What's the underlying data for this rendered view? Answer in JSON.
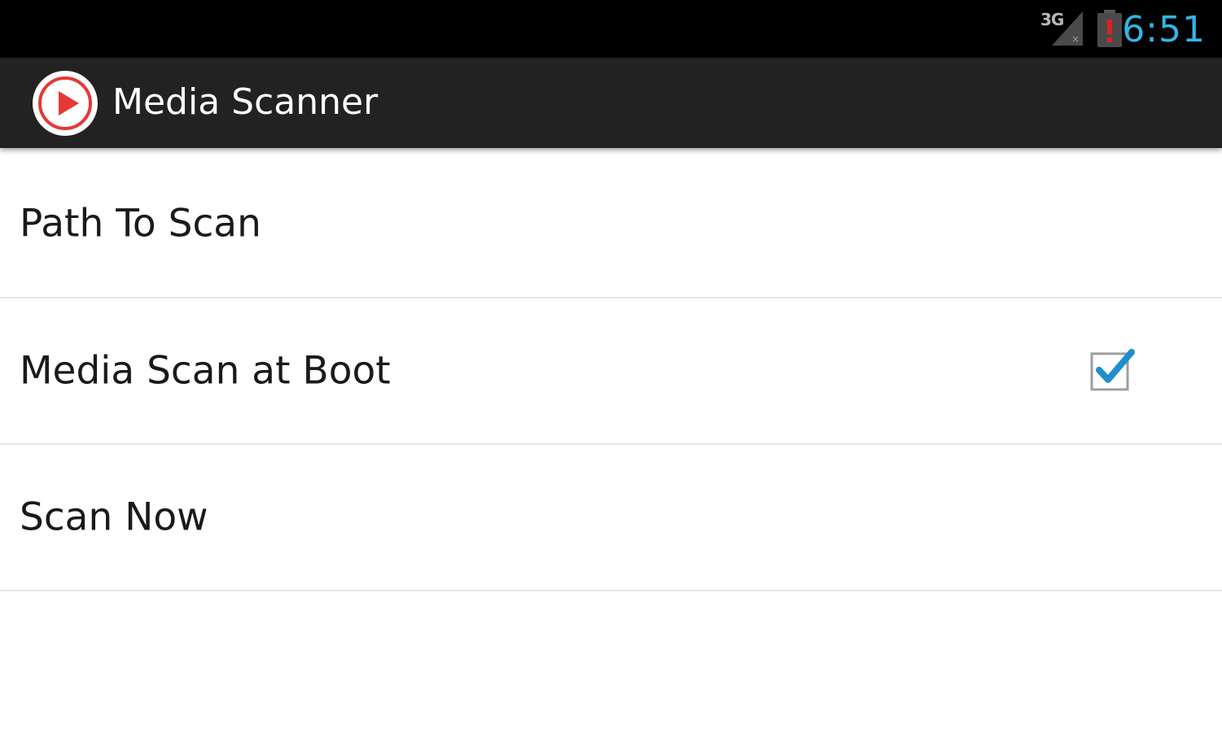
{
  "status_bar": {
    "network_label": "3G",
    "time": "6:51",
    "time_color": "#33b5e5",
    "icons": [
      "signal-icon",
      "battery-alert-icon"
    ]
  },
  "action_bar": {
    "title": "Media Scanner",
    "icon": "play-icon",
    "accent_color": "#e53935"
  },
  "preferences": [
    {
      "label": "Path To Scan"
    },
    {
      "label": "Media Scan at Boot",
      "checked": true
    },
    {
      "label": "Scan Now"
    }
  ]
}
